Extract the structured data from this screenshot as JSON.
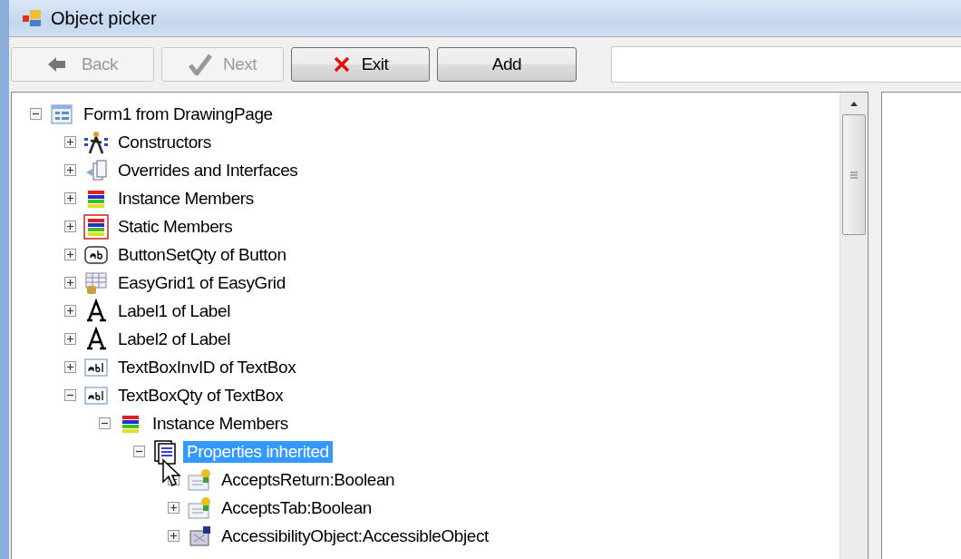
{
  "window": {
    "title": "Object picker"
  },
  "toolbar": {
    "buttons": [
      {
        "label": "Back",
        "kind": "back",
        "disabled": true
      },
      {
        "label": "Next",
        "kind": "next",
        "disabled": true
      },
      {
        "label": "Exit",
        "kind": "exit",
        "disabled": false
      },
      {
        "label": "Add",
        "kind": "plain",
        "disabled": false
      }
    ]
  },
  "tree": [
    {
      "label": "Form1 from DrawingPage",
      "kind": "form",
      "expanded": true,
      "selected": false,
      "children": [
        {
          "label": "Constructors",
          "kind": "constructor",
          "expanded": false,
          "selected": false
        },
        {
          "label": "Overrides and Interfaces",
          "kind": "overrides",
          "expanded": false,
          "selected": false
        },
        {
          "label": "Instance Members",
          "kind": "instance",
          "expanded": false,
          "selected": false
        },
        {
          "label": "Static Members",
          "kind": "static",
          "expanded": false,
          "selected": false
        },
        {
          "label": "ButtonSetQty of Button",
          "kind": "button",
          "expanded": false,
          "selected": false
        },
        {
          "label": "EasyGrid1 of EasyGrid",
          "kind": "grid",
          "expanded": false,
          "selected": false
        },
        {
          "label": "Label1 of Label",
          "kind": "label",
          "expanded": false,
          "selected": false
        },
        {
          "label": "Label2 of Label",
          "kind": "label",
          "expanded": false,
          "selected": false
        },
        {
          "label": "TextBoxInvID of TextBox",
          "kind": "textbox",
          "expanded": false,
          "selected": false
        },
        {
          "label": "TextBoxQty of TextBox",
          "kind": "textbox",
          "expanded": true,
          "selected": false,
          "children": [
            {
              "label": "Instance Members",
              "kind": "instance",
              "expanded": true,
              "selected": false,
              "children": [
                {
                  "label": "Properties inherited",
                  "kind": "properties",
                  "expanded": true,
                  "selected": true,
                  "children": [
                    {
                      "label": "AcceptsReturn:Boolean",
                      "kind": "property",
                      "expanded": false,
                      "selected": false
                    },
                    {
                      "label": "AcceptsTab:Boolean",
                      "kind": "property",
                      "expanded": false,
                      "selected": false
                    },
                    {
                      "label": "AccessibilityObject:AccessibleObject",
                      "kind": "accessible",
                      "expanded": false,
                      "selected": false
                    }
                  ]
                }
              ]
            }
          ]
        }
      ]
    }
  ]
}
